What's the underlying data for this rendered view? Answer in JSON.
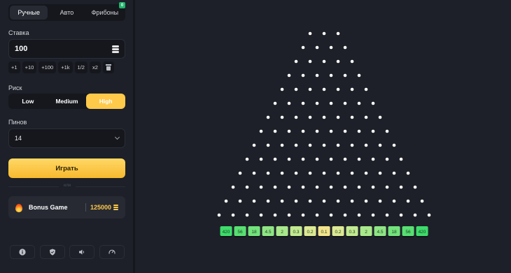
{
  "tabs": [
    {
      "label": "Ручные",
      "active": true
    },
    {
      "label": "Авто",
      "active": false
    },
    {
      "label": "Фрибоны",
      "active": false,
      "badge": "0"
    }
  ],
  "bet": {
    "label": "Ставка",
    "value": "100",
    "icon": "coins-icon"
  },
  "quick_buttons": [
    "+1",
    "+10",
    "+100",
    "+1k",
    "1/2",
    "x2"
  ],
  "risk": {
    "label": "Риск",
    "options": [
      "Low",
      "Medium",
      "High"
    ],
    "selected": "High"
  },
  "pins": {
    "label": "Пинов",
    "value": "14"
  },
  "play_label": "Играть",
  "or_label": "или",
  "bonus": {
    "title": "Bonus Game",
    "value": "125000"
  },
  "footer_icons": [
    "info-icon",
    "shield-icon",
    "sound-icon",
    "speed-icon"
  ],
  "board": {
    "rows": 14,
    "multipliers": [
      "420",
      "56",
      "18",
      "4.5",
      "2",
      "0.3",
      "0.2",
      "0.1",
      "0.2",
      "0.3",
      "2",
      "4.5",
      "18",
      "56",
      "420"
    ],
    "slot_colors": [
      "#3ddc6a",
      "#58df72",
      "#72e27b",
      "#8fe584",
      "#a9e88b",
      "#c2ea90",
      "#dce994",
      "#f3e48c",
      "#dce994",
      "#c2ea90",
      "#a9e88b",
      "#8fe584",
      "#72e27b",
      "#58df72",
      "#3ddc6a"
    ]
  }
}
